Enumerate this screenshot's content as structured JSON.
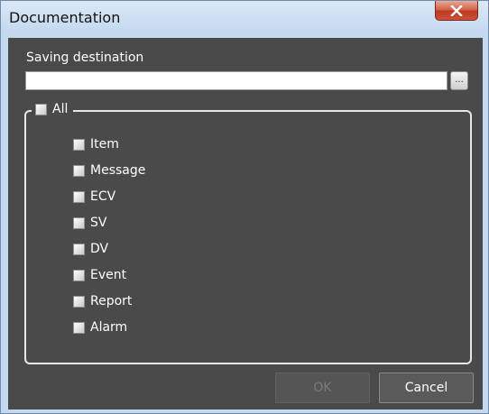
{
  "window": {
    "title": "Documentation",
    "close_glyph": "X"
  },
  "destination": {
    "label": "Saving destination",
    "value": "",
    "browse_label": "..."
  },
  "group": {
    "all_label": "All",
    "all_checked": false,
    "items": [
      {
        "label": "Item",
        "checked": false
      },
      {
        "label": "Message",
        "checked": false
      },
      {
        "label": "ECV",
        "checked": false
      },
      {
        "label": "SV",
        "checked": false
      },
      {
        "label": "DV",
        "checked": false
      },
      {
        "label": "Event",
        "checked": false
      },
      {
        "label": "Report",
        "checked": false
      },
      {
        "label": "Alarm",
        "checked": false
      }
    ]
  },
  "buttons": {
    "ok_label": "OK",
    "ok_enabled": false,
    "cancel_label": "Cancel"
  },
  "colors": {
    "client_bg": "#4a4a4a",
    "title_bg": "#c3d9ef",
    "close_red": "#c9503a"
  }
}
